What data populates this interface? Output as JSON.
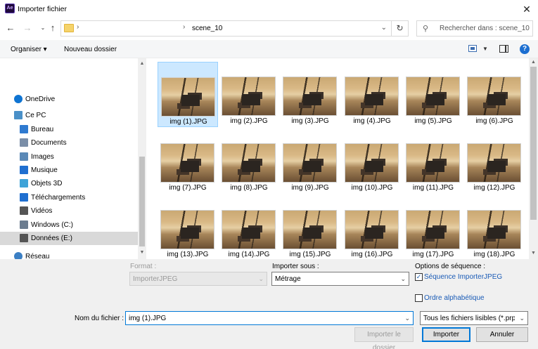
{
  "window": {
    "title": "Importer fichier",
    "app_icon": "Ae",
    "close_glyph": "✕"
  },
  "address": {
    "crumb": "scene_10",
    "separator": "›"
  },
  "search": {
    "placeholder": "Rechercher dans : scene_10"
  },
  "toolbar": {
    "organize_label": "Organiser ▾",
    "new_folder_label": "Nouveau dossier",
    "help_glyph": "?"
  },
  "nav": {
    "items": [
      {
        "label": "OneDrive",
        "icon": "onedrive-icon",
        "color": "#0f74d2"
      },
      {
        "label": "Ce PC",
        "icon": "computer-icon",
        "color": "#4a90c8"
      },
      {
        "label": "Bureau",
        "icon": "desktop-icon",
        "color": "#2f7ad0"
      },
      {
        "label": "Documents",
        "icon": "documents-icon",
        "color": "#7a8ea8"
      },
      {
        "label": "Images",
        "icon": "images-icon",
        "color": "#5b89b7"
      },
      {
        "label": "Musique",
        "icon": "music-icon",
        "color": "#1f6fd0"
      },
      {
        "label": "Objets 3D",
        "icon": "objects3d-icon",
        "color": "#3ea3d8"
      },
      {
        "label": "Téléchargements",
        "icon": "downloads-icon",
        "color": "#1f6fd0"
      },
      {
        "label": "Vidéos",
        "icon": "videos-icon",
        "color": "#555555"
      },
      {
        "label": "Windows (C:)",
        "icon": "drive-icon",
        "color": "#6b7c8f"
      },
      {
        "label": "Données (E:)",
        "icon": "drive-icon",
        "color": "#555555"
      },
      {
        "label": "Réseau",
        "icon": "network-icon",
        "color": "#3b7fc4"
      }
    ]
  },
  "files": [
    {
      "name": "img (1).JPG"
    },
    {
      "name": "img (2).JPG"
    },
    {
      "name": "img (3).JPG"
    },
    {
      "name": "img (4).JPG"
    },
    {
      "name": "img (5).JPG"
    },
    {
      "name": "img (6).JPG"
    },
    {
      "name": "img (7).JPG"
    },
    {
      "name": "img (8).JPG"
    },
    {
      "name": "img (9).JPG"
    },
    {
      "name": "img (10).JPG"
    },
    {
      "name": "img (11).JPG"
    },
    {
      "name": "img (12).JPG"
    },
    {
      "name": "img (13).JPG"
    },
    {
      "name": "img (14).JPG"
    },
    {
      "name": "img (15).JPG"
    },
    {
      "name": "img (16).JPG"
    },
    {
      "name": "img (17).JPG"
    },
    {
      "name": "img (18).JPG"
    }
  ],
  "options": {
    "format_label": "Format :",
    "format_value": "ImporterJPEG",
    "import_as_label": "Importer sous :",
    "import_as_value": "Métrage",
    "sequence_options_label": "Options de séquence :",
    "sequence_checkbox_label": "Séquence ImporterJPEG",
    "sequence_checked": true,
    "alpha_order_label": "Ordre alphabétique",
    "alpha_order_checked": false
  },
  "filename": {
    "label": "Nom du fichier :",
    "value": "img (1).JPG",
    "filter": "Tous les fichiers lisibles (*.prpro"
  },
  "buttons": {
    "import_folder": "Importer le dossier",
    "import": "Importer",
    "cancel": "Annuler"
  }
}
